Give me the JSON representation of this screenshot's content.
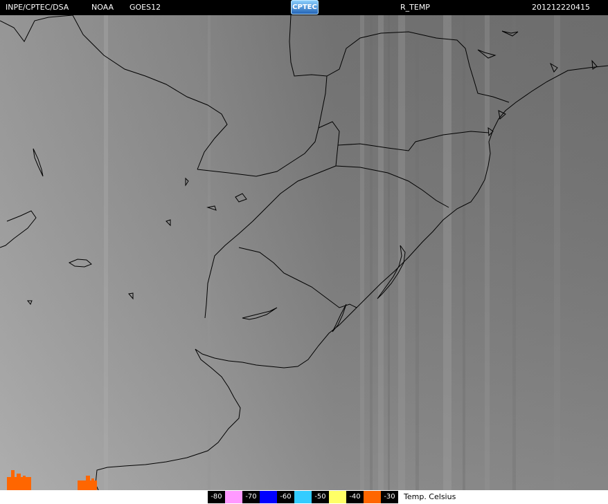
{
  "header": {
    "source": "INPE/CPTEC/DSA",
    "agency": "NOAA",
    "satellite": "GOES12",
    "logo_text": "CPTEC",
    "product": "R_TEMP",
    "timestamp": "201212220415"
  },
  "legend": {
    "units": "Temp. Celsius",
    "stops": [
      {
        "label": "-80",
        "color": "#000000"
      },
      {
        "label": "-70",
        "color": "#ff99ff"
      },
      {
        "label": "-60",
        "color": "#0000ff"
      },
      {
        "label": "-50",
        "color": "#33ccff"
      },
      {
        "label": "-40",
        "color": "#ffff66"
      },
      {
        "label": "-30",
        "color": "#ff6600"
      }
    ]
  },
  "colors": {
    "background_left": "#a8a8a8",
    "background_right": "#7a7a7a",
    "coastline": "#000000",
    "cold_cloud": "#ff6600"
  }
}
